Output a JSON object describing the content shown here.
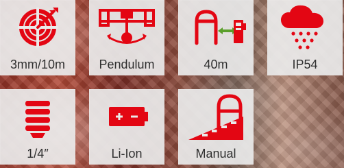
{
  "features": [
    {
      "label": "3mm/10m",
      "icon": "target-icon"
    },
    {
      "label": "Pendulum",
      "icon": "pendulum-icon"
    },
    {
      "label": "40m",
      "icon": "distance-icon"
    },
    {
      "label": "IP54",
      "icon": "rain-cloud-icon"
    },
    {
      "label": "1/4″",
      "icon": "thread-mount-icon"
    },
    {
      "label": "Li-Ion",
      "icon": "battery-icon"
    },
    {
      "label": "Manual",
      "icon": "manual-slope-icon"
    }
  ],
  "colors": {
    "accent": "#e30613",
    "tile": "#eaeaea",
    "text": "#2f2f2f"
  }
}
